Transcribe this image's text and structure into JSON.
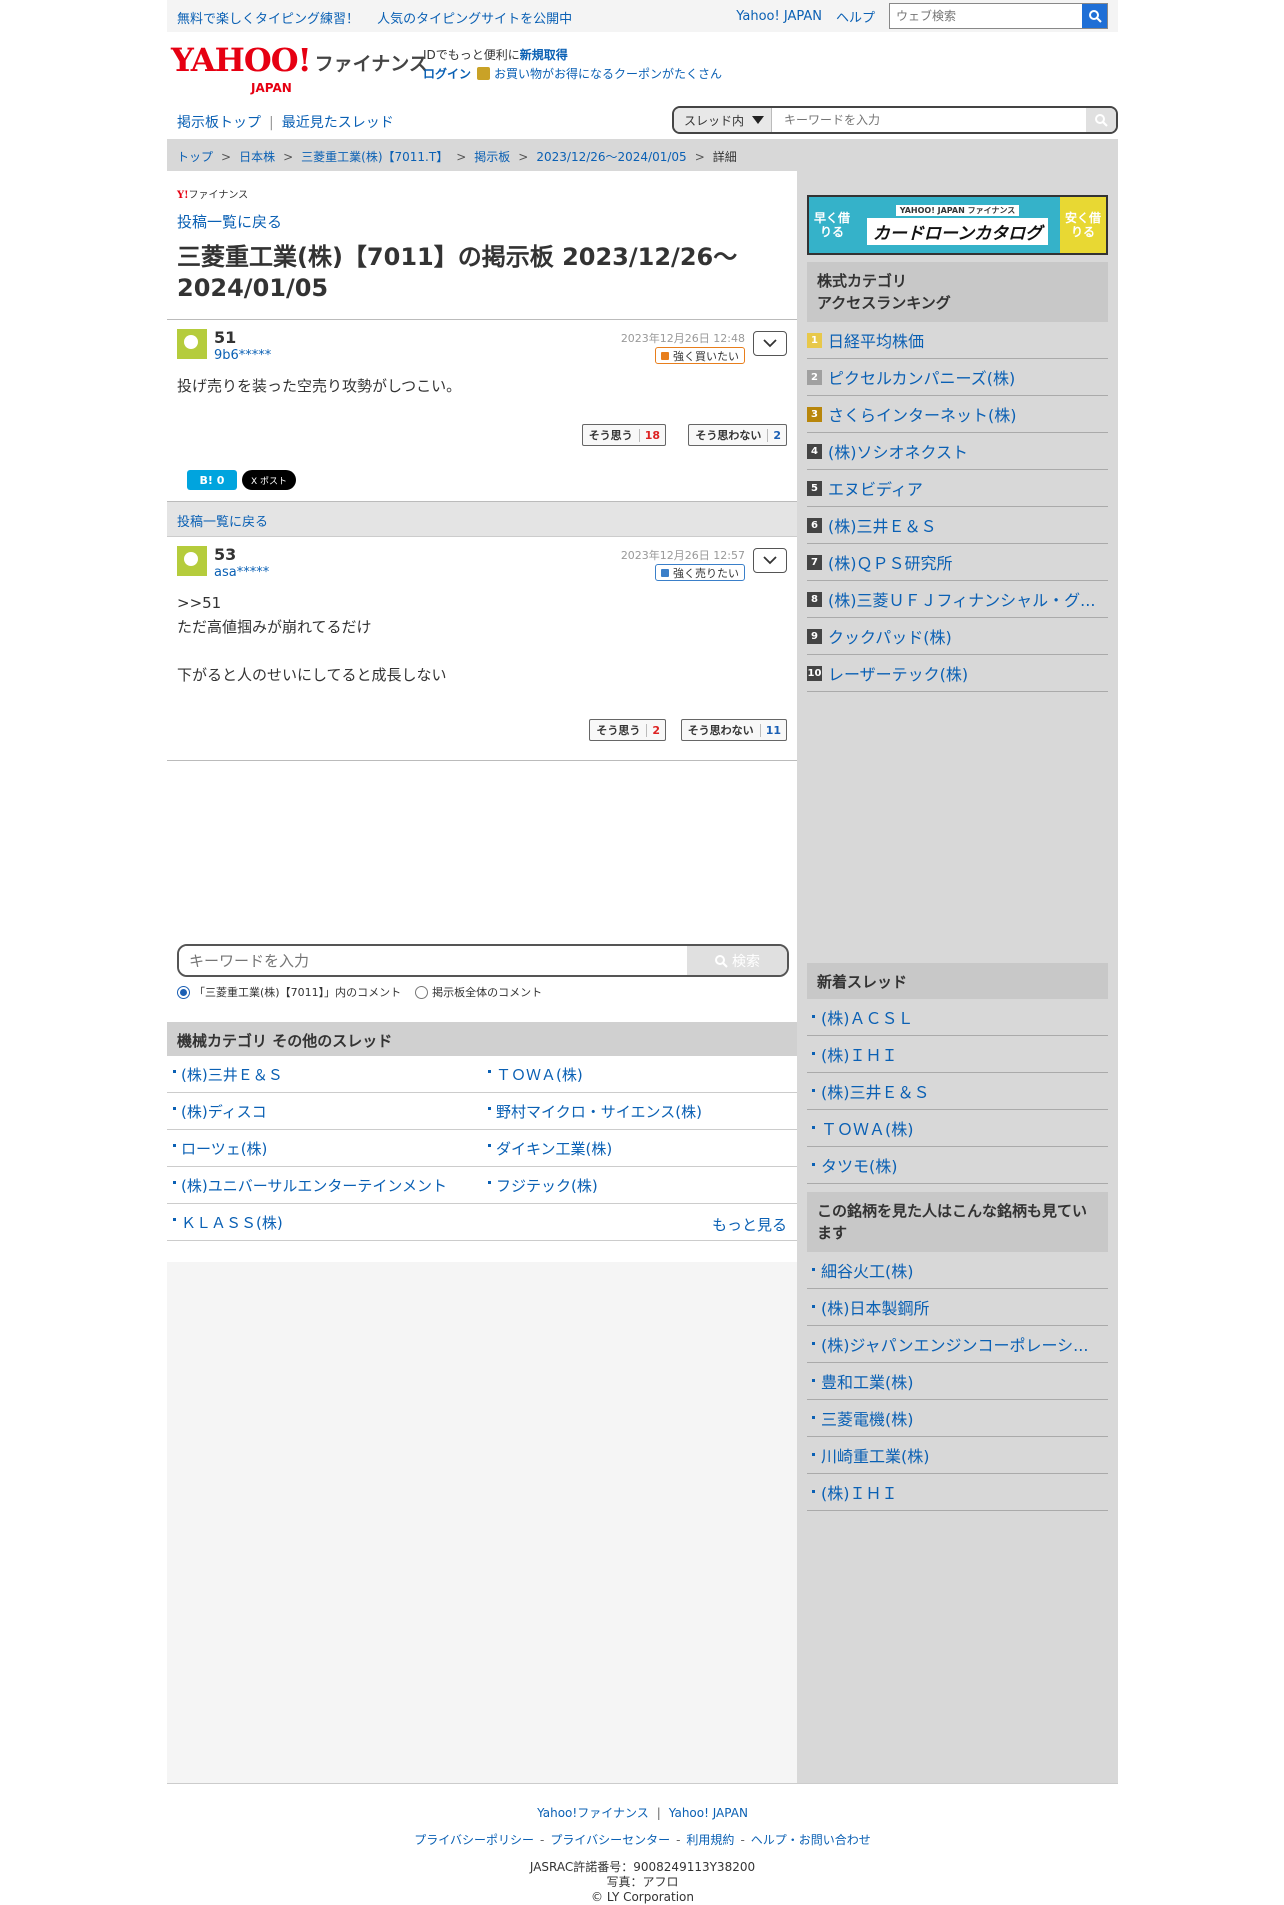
{
  "topbar": {
    "promo1": "無料で楽しくタイピング練習！",
    "promo2": "人気のタイピングサイトを公開中",
    "yahoo_japan": "Yahoo! JAPAN",
    "help": "ヘルプ",
    "web_search_placeholder": "ウェブ検索"
  },
  "header": {
    "logo_main": "YAHOO!",
    "logo_sub": "JAPAN",
    "logo_fin": "ファイナンス",
    "id_text": "IDでもっと便利に",
    "signup": "新規取得",
    "login": "ログイン",
    "coupon": "お買い物がお得になるクーポンがたくさん"
  },
  "subnav": {
    "board_top": "掲示板トップ",
    "recent": "最近見たスレッド",
    "scope": "スレッド内",
    "keyword_placeholder": "キーワードを入力"
  },
  "breadcrumb": {
    "items": [
      "トップ",
      "日本株",
      "三菱重工業(株)【7011.T】",
      "掲示板",
      "2023/12/26〜2024/01/05"
    ],
    "current": "詳細"
  },
  "main": {
    "small_logo_y": "Y!",
    "small_logo_fin": "ファイナンス",
    "back_to_list": "投稿一覧に戻る",
    "title": "三菱重工業(株)【7011】の掲示板 2023/12/26〜2024/01/05",
    "posts": [
      {
        "num": "51",
        "user": "9b6*****",
        "date": "2023年12月26日 12:48",
        "sentiment": "強く買いたい",
        "body": "投げ売りを装った空売り攻勢がしつこい。",
        "agree_label": "そう思う",
        "agree_count": "18",
        "disagree_label": "そう思わない",
        "disagree_count": "2"
      },
      {
        "num": "53",
        "user": "asa*****",
        "date": "2023年12月26日 12:57",
        "sentiment": "強く売りたい",
        "body_lines": [
          ">>51",
          "ただ高値掴みが崩れてるだけ",
          "",
          "下がると人のせいにしてると成長しない"
        ],
        "agree_label": "そう思う",
        "agree_count": "2",
        "disagree_label": "そう思わない",
        "disagree_count": "11"
      }
    ],
    "hatena": "B! 0",
    "x_share": "X ポスト",
    "backbar": "投稿一覧に戻る",
    "search_placeholder": "キーワードを入力",
    "search_button": "検索",
    "radio_thread": "「三菱重工業(株)【7011】」内のコメント",
    "radio_all": "掲示板全体のコメント",
    "category_heading": "機械カテゴリ その他のスレッド",
    "category_items": [
      "(株)三井Ｅ＆Ｓ",
      "ＴＯＷＡ(株)",
      "(株)ディスコ",
      "野村マイクロ・サイエンス(株)",
      "ローツェ(株)",
      "ダイキン工業(株)",
      "(株)ユニバーサルエンターテインメント",
      "フジテック(株)",
      "ＫＬＡＳＳ(株)"
    ],
    "more": "もっと見る"
  },
  "side": {
    "banner_left": "早く借りる",
    "banner_brand": "YAHOO! JAPAN ファイナンス",
    "banner_title": "カードローンカタログ",
    "banner_right": "安く借りる",
    "ranking_heading_1": "株式カテゴリ",
    "ranking_heading_2": "アクセスランキング",
    "ranking": [
      {
        "n": "1",
        "name": "日経平均株価",
        "color": "#e8c84a"
      },
      {
        "n": "2",
        "name": "ピクセルカンパニーズ(株)",
        "color": "#a0a0a0"
      },
      {
        "n": "3",
        "name": "さくらインターネット(株)",
        "color": "#b8860b"
      },
      {
        "n": "4",
        "name": "(株)ソシオネクスト",
        "color": "#444444"
      },
      {
        "n": "5",
        "name": "エヌビディア",
        "color": "#444444"
      },
      {
        "n": "6",
        "name": "(株)三井Ｅ＆Ｓ",
        "color": "#444444"
      },
      {
        "n": "7",
        "name": "(株)ＱＰＳ研究所",
        "color": "#444444"
      },
      {
        "n": "8",
        "name": "(株)三菱ＵＦＪフィナンシャル・グ...",
        "color": "#444444"
      },
      {
        "n": "9",
        "name": "クックパッド(株)",
        "color": "#444444"
      },
      {
        "n": "10",
        "name": "レーザーテック(株)",
        "color": "#444444"
      }
    ],
    "new_heading": "新着スレッド",
    "new_threads": [
      "(株)ＡＣＳＬ",
      "(株)ＩＨＩ",
      "(株)三井Ｅ＆Ｓ",
      "ＴＯＷＡ(株)",
      "タツモ(株)"
    ],
    "also_heading": "この銘柄を見た人はこんな銘柄も見ています",
    "also": [
      "細谷火工(株)",
      "(株)日本製鋼所",
      "(株)ジャパンエンジンコーポレーシ...",
      "豊和工業(株)",
      "三菱電機(株)",
      "川崎重工業(株)",
      "(株)ＩＨＩ"
    ]
  },
  "footer": {
    "fin": "Yahoo!ファイナンス",
    "yj": "Yahoo! JAPAN",
    "links": [
      "プライバシーポリシー",
      "プライバシーセンター",
      "利用規約",
      "ヘルプ・お問い合わせ"
    ],
    "jasrac": "JASRAC許諾番号：9008249113Y38200",
    "photo": "写真：アフロ",
    "copy": "© LY Corporation"
  },
  "colors": {
    "link": "#0a60b4",
    "buy": "#e87e1c",
    "sell": "#3a7fc9",
    "brand_red": "#e60012"
  }
}
